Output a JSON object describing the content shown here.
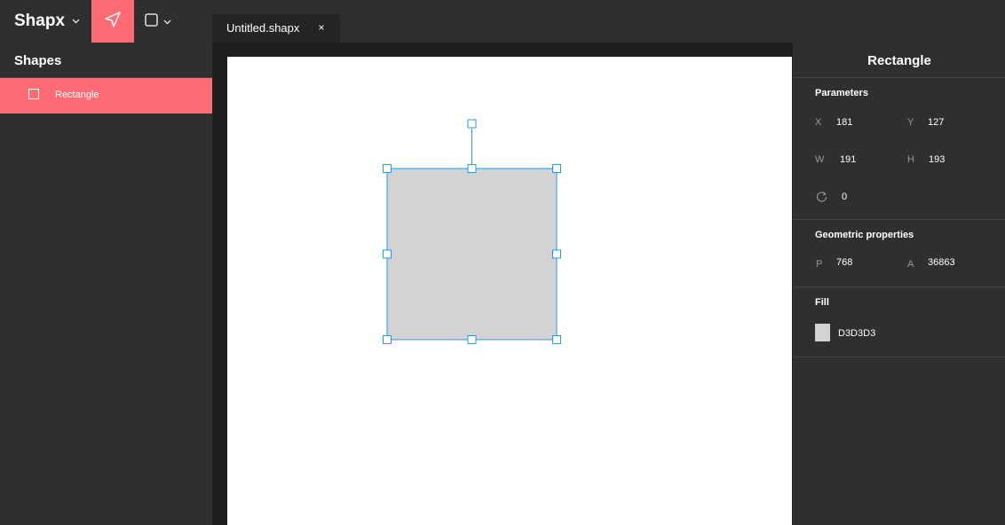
{
  "app": {
    "name": "Shapx"
  },
  "toolbar": {
    "select_tool_icon": "cursor-arrow-icon",
    "shape_tool_icon": "square-icon",
    "accent_color": "#ff6b74"
  },
  "tabs": [
    {
      "label": "Untitled.shapx",
      "close": "×"
    }
  ],
  "shapes_panel": {
    "title": "Shapes",
    "items": [
      {
        "label": "Rectangle",
        "icon": "square-icon",
        "selected": true
      }
    ]
  },
  "canvas": {
    "shape": {
      "type": "rectangle",
      "fill": "#D3D3D3",
      "selection_color": "#1e9be9"
    }
  },
  "properties": {
    "title": "Rectangle",
    "parameters": {
      "title": "Parameters",
      "x_label": "X",
      "x": "181",
      "y_label": "Y",
      "y": "127",
      "w_label": "W",
      "w": "191",
      "h_label": "H",
      "h": "193",
      "rotation_icon": "rotate-icon",
      "rotation": "0"
    },
    "geometric": {
      "title": "Geometric properties",
      "p_label": "P",
      "p": "768",
      "a_label": "A",
      "a": "36863"
    },
    "fill": {
      "title": "Fill",
      "color": "D3D3D3"
    }
  }
}
